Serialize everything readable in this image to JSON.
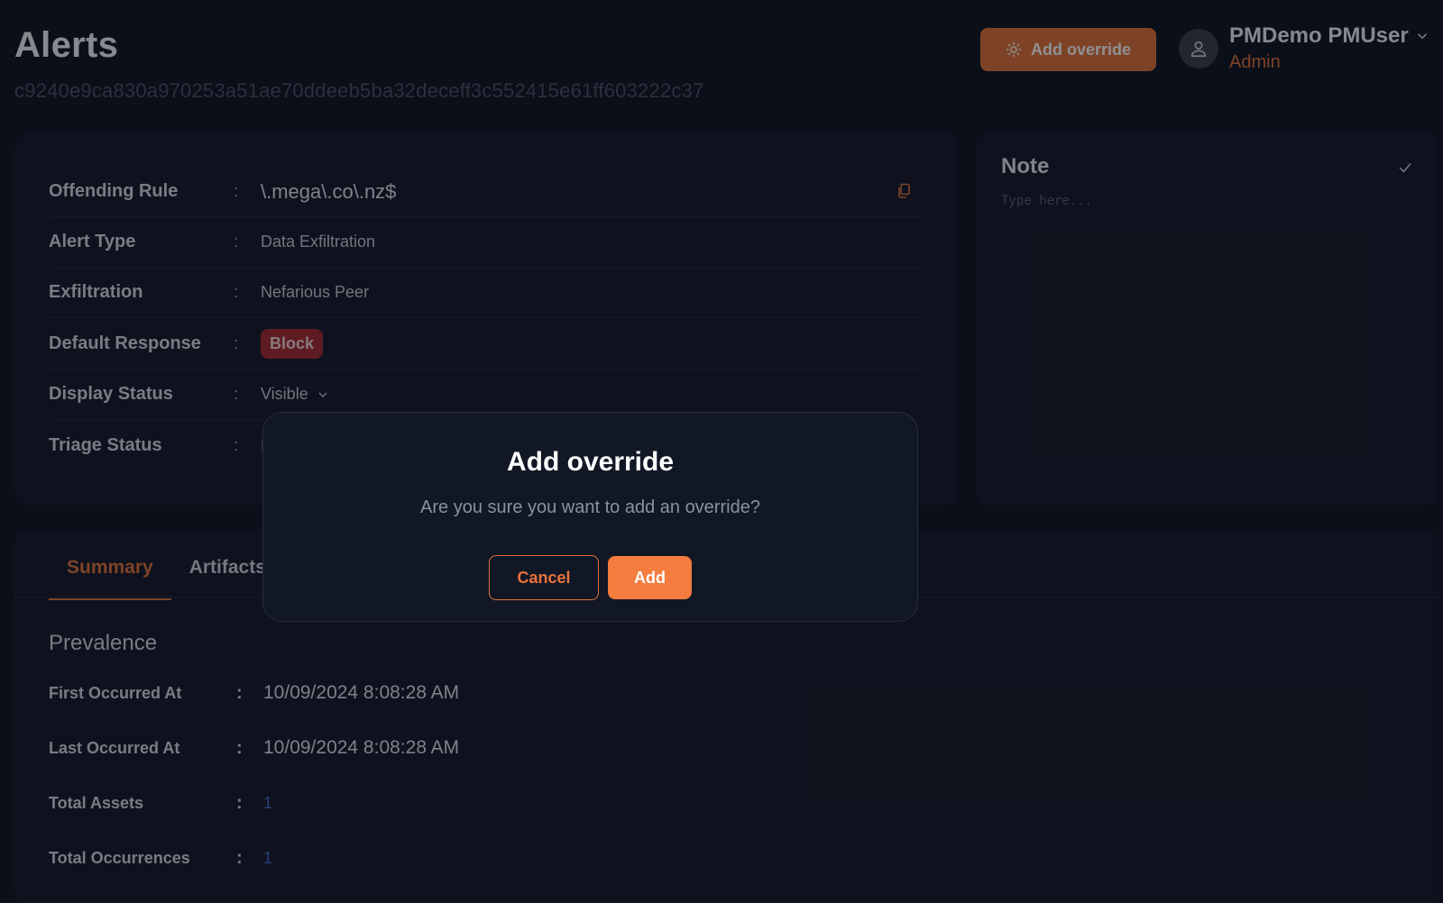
{
  "header": {
    "title": "Alerts",
    "alert_id": "c9240e9ca830a970253a51ae70ddeeb5ba32deceff3c552415e61ff603222c37",
    "add_override_label": "Add override"
  },
  "user": {
    "name": "PMDemo PMUser",
    "role": "Admin"
  },
  "details": {
    "rows": [
      {
        "label": "Offending Rule",
        "value": "\\.mega\\.co\\.nz$"
      },
      {
        "label": "Alert Type",
        "value": "Data Exfiltration"
      },
      {
        "label": "Exfiltration",
        "value": "Nefarious Peer"
      },
      {
        "label": "Default Response",
        "value": "Block"
      },
      {
        "label": "Display Status",
        "value": "Visible"
      },
      {
        "label": "Triage Status",
        "value": "I"
      }
    ],
    "colon": ":"
  },
  "note": {
    "title": "Note",
    "placeholder": "Type here..."
  },
  "tabs": [
    {
      "label": "Summary",
      "active": true
    },
    {
      "label": "Artifacts",
      "active": false
    }
  ],
  "prevalence": {
    "title": "Prevalence",
    "rows": [
      {
        "label": "First Occurred At",
        "value": "10/09/2024 8:08:28 AM"
      },
      {
        "label": "Last Occurred At",
        "value": "10/09/2024 8:08:28 AM"
      },
      {
        "label": "Total Assets",
        "value": "1"
      },
      {
        "label": "Total Occurrences",
        "value": "1"
      }
    ]
  },
  "modal": {
    "title": "Add override",
    "message": "Are you sure you want to add an override?",
    "cancel_label": "Cancel",
    "add_label": "Add"
  },
  "colors": {
    "accent": "#e0733a",
    "background": "#0f1422",
    "card": "#161b2a",
    "block_badge": "#a72b31",
    "link": "#4870d8"
  }
}
